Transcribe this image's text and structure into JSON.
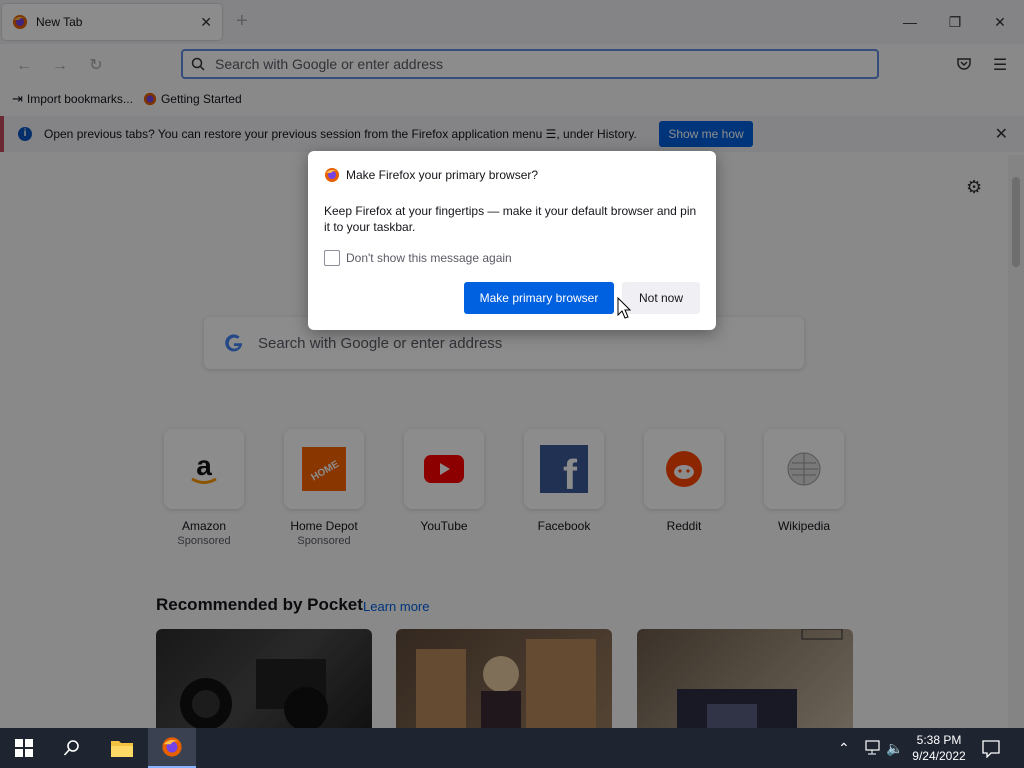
{
  "tab": {
    "title": "New Tab"
  },
  "urlbar": {
    "placeholder": "Search with Google or enter address"
  },
  "bookmarks": [
    {
      "label": "Import bookmarks..."
    },
    {
      "label": "Getting Started"
    }
  ],
  "notification": {
    "message": "Open previous tabs? You can restore your previous session from the Firefox application menu ☰, under History.",
    "button": "Show me how"
  },
  "content": {
    "search_placeholder": "Search with Google or enter address",
    "top_sites": [
      {
        "name": "Amazon",
        "sponsored": "Sponsored"
      },
      {
        "name": "Home Depot",
        "sponsored": "Sponsored"
      },
      {
        "name": "YouTube"
      },
      {
        "name": "Facebook"
      },
      {
        "name": "Reddit"
      },
      {
        "name": "Wikipedia"
      }
    ],
    "pocket_title": "Recommended by Pocket",
    "pocket_link": "Learn more"
  },
  "dialog": {
    "title": "Make Firefox your primary browser?",
    "body": "Keep Firefox at your fingertips — make it your default browser and pin it to your taskbar.",
    "checkbox_label": "Don't show this message again",
    "primary_button": "Make primary browser",
    "secondary_button": "Not now"
  },
  "taskbar": {
    "time": "5:38 PM",
    "date": "9/24/2022"
  },
  "colors": {
    "accent": "#0061e0",
    "taskbar": "#1e2430"
  }
}
